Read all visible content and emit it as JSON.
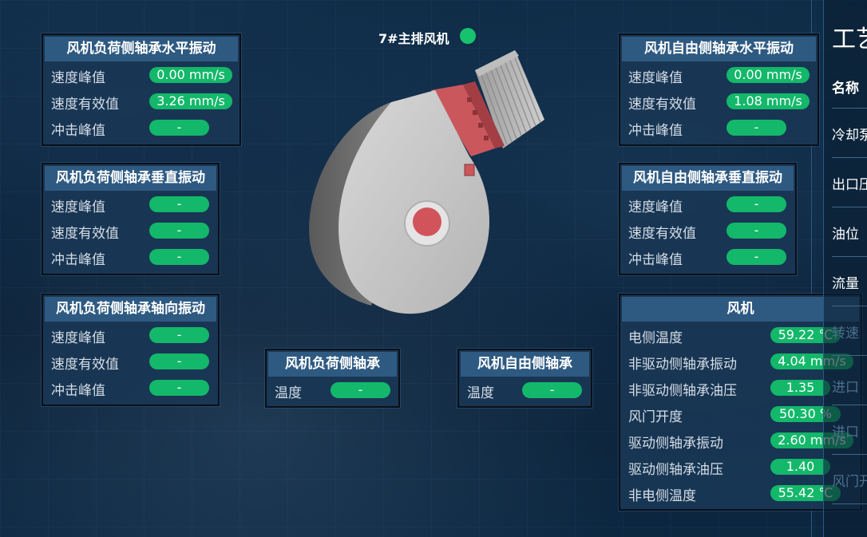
{
  "fan": {
    "title": "7#主排风机",
    "status_color": "#16c26e"
  },
  "panels": {
    "load_horizontal": {
      "title": "风机负荷侧轴承水平振动",
      "rows": [
        {
          "label": "速度峰值",
          "value": "0.00 mm/s"
        },
        {
          "label": "速度有效值",
          "value": "3.26 mm/s"
        },
        {
          "label": "冲击峰值",
          "value": "-"
        }
      ]
    },
    "load_vertical": {
      "title": "风机负荷侧轴承垂直振动",
      "rows": [
        {
          "label": "速度峰值",
          "value": "-"
        },
        {
          "label": "速度有效值",
          "value": "-"
        },
        {
          "label": "冲击峰值",
          "value": "-"
        }
      ]
    },
    "load_axial": {
      "title": "风机负荷侧轴承轴向振动",
      "rows": [
        {
          "label": "速度峰值",
          "value": "-"
        },
        {
          "label": "速度有效值",
          "value": "-"
        },
        {
          "label": "冲击峰值",
          "value": "-"
        }
      ]
    },
    "load_bearing": {
      "title": "风机负荷侧轴承",
      "rows": [
        {
          "label": "温度",
          "value": "-"
        }
      ]
    },
    "free_bearing": {
      "title": "风机自由侧轴承",
      "rows": [
        {
          "label": "温度",
          "value": "-"
        }
      ]
    },
    "free_horizontal": {
      "title": "风机自由侧轴承水平振动",
      "rows": [
        {
          "label": "速度峰值",
          "value": "0.00 mm/s"
        },
        {
          "label": "速度有效值",
          "value": "1.08 mm/s"
        },
        {
          "label": "冲击峰值",
          "value": "-"
        }
      ]
    },
    "free_vertical": {
      "title": "风机自由侧轴承垂直振动",
      "rows": [
        {
          "label": "速度峰值",
          "value": "-"
        },
        {
          "label": "速度有效值",
          "value": "-"
        },
        {
          "label": "冲击峰值",
          "value": "-"
        }
      ]
    },
    "motor": {
      "title": "风机",
      "rows": [
        {
          "label": "电侧温度",
          "value": "59.22 ℃"
        },
        {
          "label": "非驱动侧轴承振动",
          "value": "4.04 mm/s"
        },
        {
          "label": "非驱动侧轴承油压",
          "value": "1.35"
        },
        {
          "label": "风门开度",
          "value": "50.30 %"
        },
        {
          "label": "驱动侧轴承振动",
          "value": "2.60 mm/s"
        },
        {
          "label": "驱动侧轴承油压",
          "value": "1.40"
        },
        {
          "label": "非电侧温度",
          "value": "55.42 ℃"
        }
      ]
    }
  },
  "right_panel": {
    "title": "工艺",
    "header": "名称",
    "items": [
      "冷却泵",
      "出口压",
      "油位",
      "流量",
      "转速",
      "进口",
      "进口",
      "风门开"
    ]
  },
  "colors": {
    "pill": "#13b86a",
    "title_bar": "#2e5a82",
    "panel_bg": "#193755"
  }
}
